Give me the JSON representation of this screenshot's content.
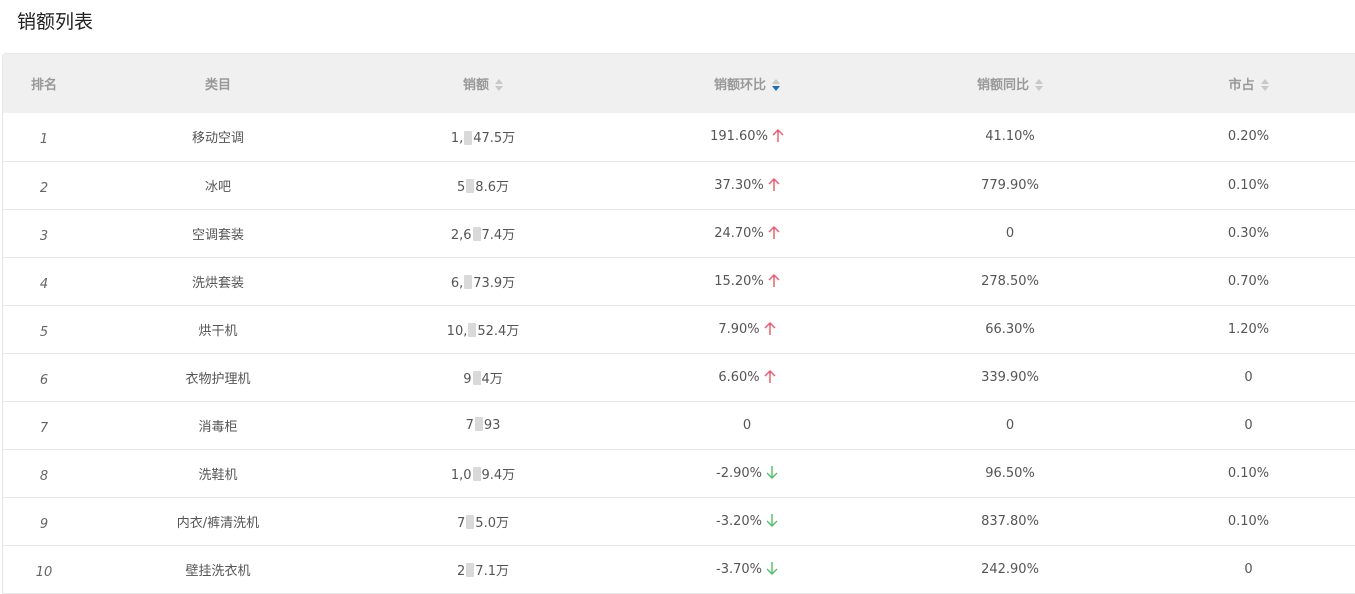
{
  "title": "销额列表",
  "colors": {
    "up": "#e8576a",
    "down": "#4fbf6a",
    "sort_active": "#1a6fb8",
    "sort_inactive": "#c8c8c8"
  },
  "table": {
    "headers": {
      "rank": "排名",
      "category": "类目",
      "sales": "销额",
      "mom": "销额环比",
      "yoy": "销额同比",
      "share": "市占"
    },
    "sort_icons": {
      "sales": "sort-both-icon",
      "mom": "sort-desc-active-icon",
      "yoy": "sort-both-icon",
      "share": "sort-both-icon"
    },
    "rows": [
      {
        "rank": "1",
        "category": "移动空调",
        "sales_pre": "1,",
        "sales_post": "47.5万",
        "mom": "191.60%",
        "trend": "up",
        "yoy": "41.10%",
        "share": "0.20%"
      },
      {
        "rank": "2",
        "category": "冰吧",
        "sales_pre": "5",
        "sales_post": "8.6万",
        "mom": "37.30%",
        "trend": "up",
        "yoy": "779.90%",
        "share": "0.10%"
      },
      {
        "rank": "3",
        "category": "空调套装",
        "sales_pre": "2,6",
        "sales_post": "7.4万",
        "mom": "24.70%",
        "trend": "up",
        "yoy": "0",
        "share": "0.30%"
      },
      {
        "rank": "4",
        "category": "洗烘套装",
        "sales_pre": "6,",
        "sales_post": "73.9万",
        "mom": "15.20%",
        "trend": "up",
        "yoy": "278.50%",
        "share": "0.70%"
      },
      {
        "rank": "5",
        "category": "烘干机",
        "sales_pre": "10,",
        "sales_post": "52.4万",
        "mom": "7.90%",
        "trend": "up",
        "yoy": "66.30%",
        "share": "1.20%"
      },
      {
        "rank": "6",
        "category": "衣物护理机",
        "sales_pre": "9",
        "sales_post": "4万",
        "mom": "6.60%",
        "trend": "up",
        "yoy": "339.90%",
        "share": "0"
      },
      {
        "rank": "7",
        "category": "消毒柜",
        "sales_pre": "7",
        "sales_post": "93",
        "mom": "0",
        "trend": "none",
        "yoy": "0",
        "share": "0"
      },
      {
        "rank": "8",
        "category": "洗鞋机",
        "sales_pre": "1,0",
        "sales_post": "9.4万",
        "mom": "-2.90%",
        "trend": "down",
        "yoy": "96.50%",
        "share": "0.10%"
      },
      {
        "rank": "9",
        "category": "内衣/裤清洗机",
        "sales_pre": "7",
        "sales_post": "5.0万",
        "mom": "-3.20%",
        "trend": "down",
        "yoy": "837.80%",
        "share": "0.10%"
      },
      {
        "rank": "10",
        "category": "壁挂洗衣机",
        "sales_pre": "2",
        "sales_post": "7.1万",
        "mom": "-3.70%",
        "trend": "down",
        "yoy": "242.90%",
        "share": "0"
      }
    ]
  }
}
